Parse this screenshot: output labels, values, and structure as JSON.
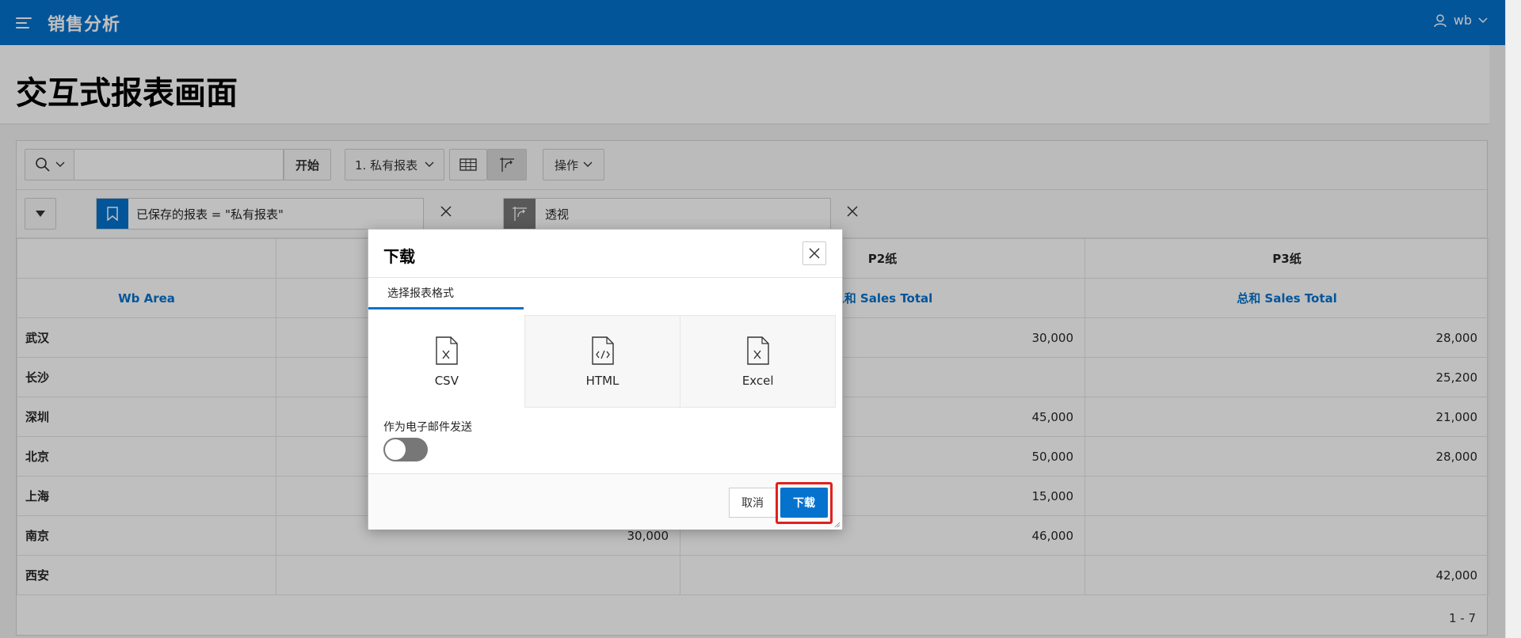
{
  "app": {
    "title": "销售分析",
    "user": "wb"
  },
  "page": {
    "title": "交互式报表画面"
  },
  "toolbar": {
    "go_label": "开始",
    "report_select": "1. 私有报表",
    "actions_label": "操作"
  },
  "filters": [
    {
      "label": "已保存的报表 = \"私有报表\""
    },
    {
      "label": "透视"
    }
  ],
  "report": {
    "pivot_headers": [
      "",
      "",
      "P2纸",
      "P3纸"
    ],
    "column_headers": [
      "Wb Area",
      "",
      "总和 Sales Total",
      "总和 Sales Total"
    ],
    "rows": [
      {
        "area": "武汉",
        "p1": "",
        "p2": "30,000",
        "p3": "28,000"
      },
      {
        "area": "长沙",
        "p1": "",
        "p2": "",
        "p3": "25,200"
      },
      {
        "area": "深圳",
        "p1": "",
        "p2": "45,000",
        "p3": "21,000"
      },
      {
        "area": "北京",
        "p1": "",
        "p2": "50,000",
        "p3": "28,000"
      },
      {
        "area": "上海",
        "p1": "",
        "p2": "15,000",
        "p3": ""
      },
      {
        "area": "南京",
        "p1": "30,000",
        "p2": "46,000",
        "p3": ""
      },
      {
        "area": "西安",
        "p1": "",
        "p2": "",
        "p3": "42,000"
      }
    ],
    "pagination": "1 - 7"
  },
  "dialog": {
    "title": "下载",
    "tab_label": "选择报表格式",
    "formats": [
      {
        "label": "CSV",
        "icon": "csv-file-icon"
      },
      {
        "label": "HTML",
        "icon": "html-file-icon"
      },
      {
        "label": "Excel",
        "icon": "excel-file-icon"
      }
    ],
    "email_label": "作为电子邮件发送",
    "email_enabled": false,
    "cancel_label": "取消",
    "download_label": "下载"
  },
  "colors": {
    "brand": "#0572ce",
    "highlight": "#e0211e"
  }
}
